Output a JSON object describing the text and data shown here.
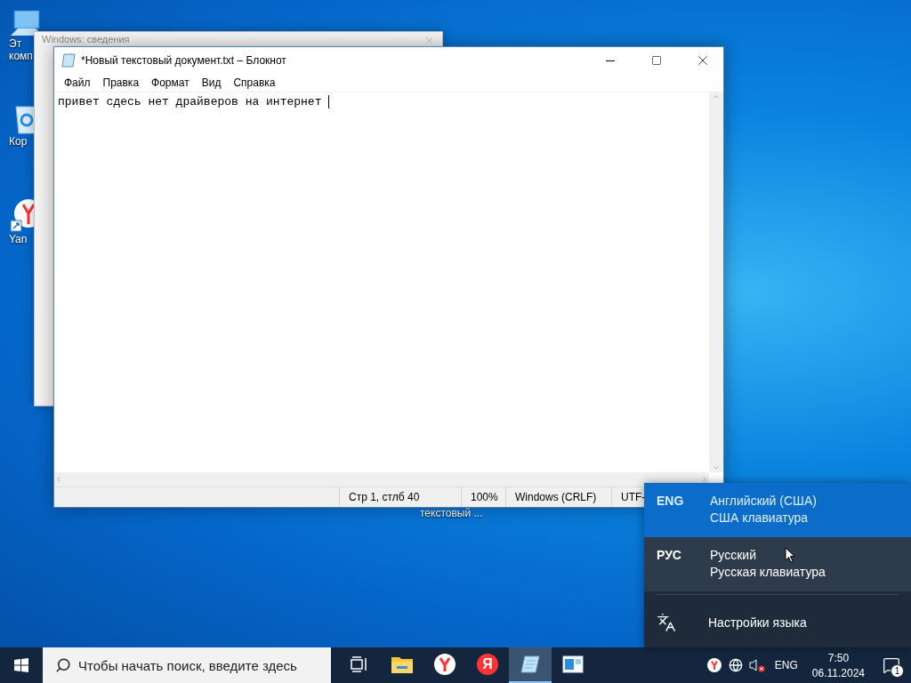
{
  "desktop": {
    "icons": [
      {
        "kind": "computer",
        "label_lines": [
          "Эт",
          "комп"
        ]
      },
      {
        "kind": "recycle",
        "label_lines": [
          "Кор"
        ]
      },
      {
        "kind": "yandex",
        "label_lines": [
          "Yan"
        ]
      }
    ],
    "covered_icon_label": "текстовый ..."
  },
  "background_window": {
    "title": "Windows: сведения"
  },
  "notepad": {
    "title": "*Новый текстовый документ.txt – Блокнот",
    "menu": [
      "Файл",
      "Правка",
      "Формат",
      "Вид",
      "Справка"
    ],
    "text": "привет сдесь нет драйверов на интернет ",
    "status": [
      "Стр 1, стлб 40",
      "100%",
      "Windows (CRLF)",
      "UTF-"
    ]
  },
  "language_flyout": {
    "languages": [
      {
        "code": "ENG",
        "name": "Английский (США)",
        "keyboard": "США клавиатура",
        "selected": true,
        "hovered": false
      },
      {
        "code": "РУС",
        "name": "Русский",
        "keyboard": "Русская клавиатура",
        "selected": false,
        "hovered": true
      }
    ],
    "settings": "Настройки языка"
  },
  "taskbar": {
    "search": {
      "placeholder": "Чтобы начать поиск, введите здесь"
    },
    "apps": [
      {
        "kind": "task-view",
        "active": false
      },
      {
        "kind": "explorer",
        "active": false
      },
      {
        "kind": "yandex-browser",
        "active": false
      },
      {
        "kind": "yandex",
        "glyph": "Я",
        "active": false
      },
      {
        "kind": "notepad",
        "active": true
      },
      {
        "kind": "window",
        "active": false
      }
    ],
    "tray": {
      "language": "ENG",
      "time": "7:50",
      "date": "06.11.2024",
      "notifications": "1"
    }
  }
}
